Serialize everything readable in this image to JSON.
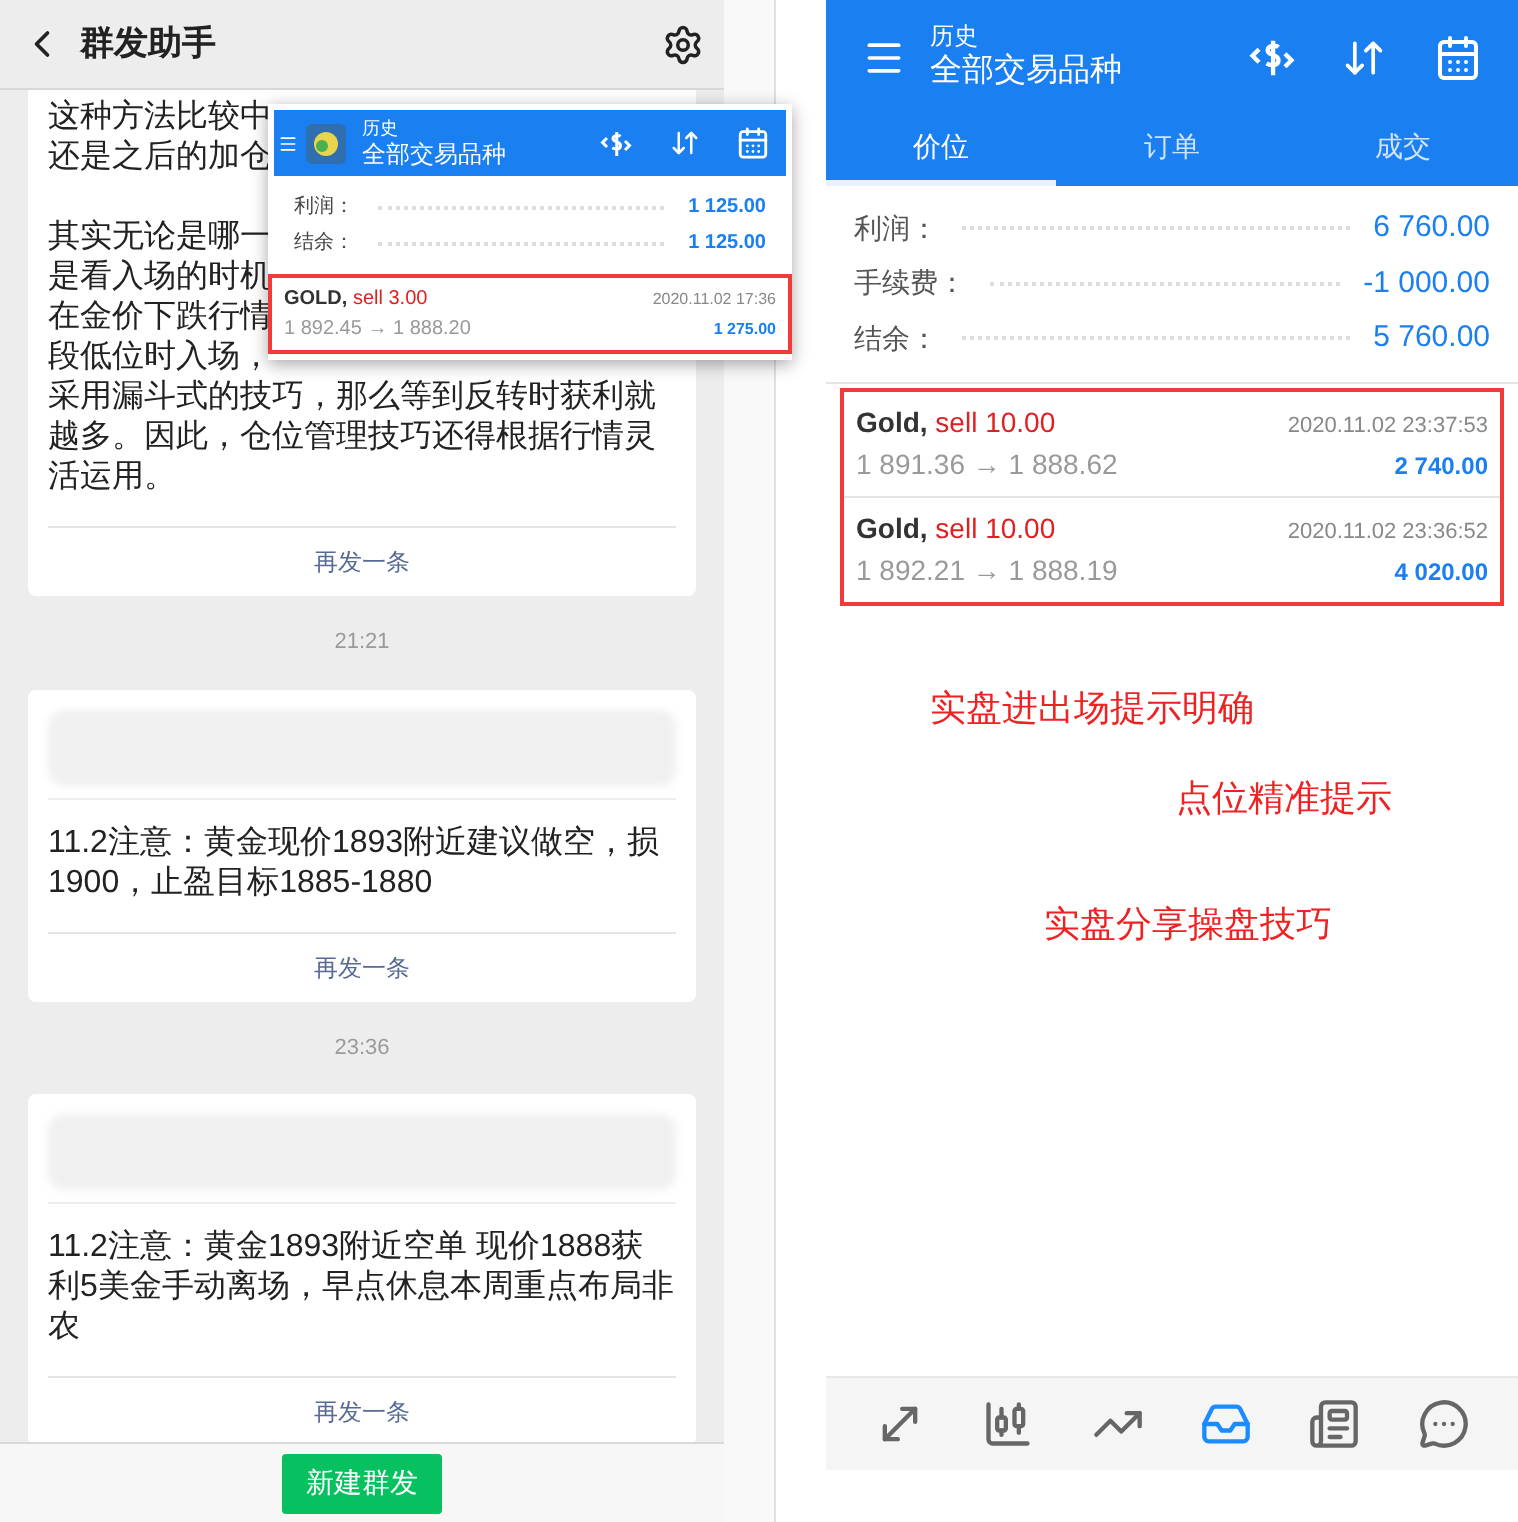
{
  "left_screen": {
    "title": "群发助手",
    "messages": [
      {
        "lines": [
          "这种方法比较中",
          "还是之后的加仓"
        ],
        "lines_after_gap": [
          "其实无论是哪一",
          "是看入场的时机",
          "在金价下跌行情",
          "段低位时入场，",
          "采用漏斗式的技巧，那么等到反转时获利就",
          "越多。因此，仓位管理技巧还得根据行情灵",
          "活运用。"
        ],
        "resend": "再发一条"
      },
      {
        "time": "21:21",
        "redacted": true,
        "lines": [
          "11.2注意：黄金现价1893附近建议做空，损",
          "1900，止盈目标1885-1880"
        ],
        "resend": "再发一条"
      },
      {
        "time": "23:36",
        "redacted": true,
        "lines": [
          "11.2注意：黄金1893附近空单 现价1888获",
          "利5美金手动离场，早点休息本周重点布局非",
          "农"
        ],
        "resend": "再发一条"
      }
    ],
    "new_button": "新建群发"
  },
  "overlay": {
    "subtitle": "历史",
    "title": "全部交易品种",
    "summary": [
      {
        "label": "利润：",
        "value": "1 125.00"
      },
      {
        "label": "结余：",
        "value": "1 125.00"
      }
    ],
    "trades": [
      {
        "symbol": "GOLD,",
        "side": "sell 3.00",
        "prices": "1 892.45 → 1 888.20",
        "time": "2020.11.02 17:36",
        "profit": "1 275.00"
      }
    ]
  },
  "right_screen": {
    "subtitle": "历史",
    "title": "全部交易品种",
    "tabs": [
      {
        "label": "价位",
        "selected": true
      },
      {
        "label": "订单",
        "selected": false
      },
      {
        "label": "成交",
        "selected": false
      }
    ],
    "summary": [
      {
        "label": "利润：",
        "value": "6 760.00"
      },
      {
        "label": "手续费：",
        "value": "-1 000.00"
      },
      {
        "label": "结余：",
        "value": "5 760.00"
      }
    ],
    "trades": [
      {
        "symbol": "Gold,",
        "side": "sell 10.00",
        "prices": "1 891.36 → 1 888.62",
        "time": "2020.11.02 23:37:53",
        "profit": "2 740.00"
      },
      {
        "symbol": "Gold,",
        "side": "sell 10.00",
        "prices": "1 892.21 → 1 888.19",
        "time": "2020.11.02 23:36:52",
        "profit": "4 020.00"
      }
    ],
    "annotations": [
      "实盘进出场提示明确",
      "点位精准提示",
      "实盘分享操盘技巧"
    ],
    "nav": [
      {
        "kind": "trade",
        "selected": false
      },
      {
        "kind": "candles",
        "selected": false
      },
      {
        "kind": "trend",
        "selected": false
      },
      {
        "kind": "inbox",
        "selected": true
      },
      {
        "kind": "news",
        "selected": false
      },
      {
        "kind": "chat",
        "selected": false
      }
    ]
  }
}
